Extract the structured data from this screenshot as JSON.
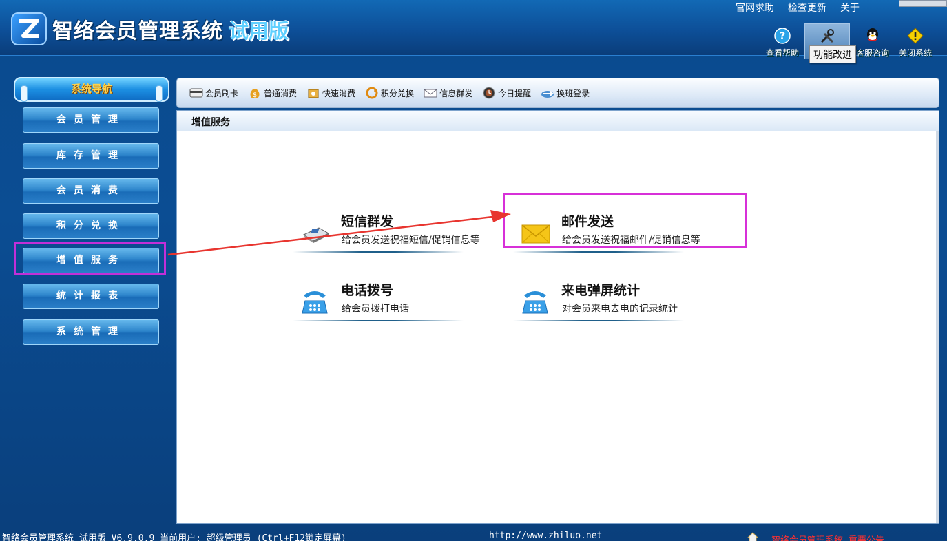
{
  "app": {
    "title": "智络会员管理系统",
    "edition": "试用版"
  },
  "top_links": [
    "官网求助",
    "检查更新",
    "关于"
  ],
  "tools": [
    {
      "label": "查看帮助",
      "icon": "help-icon"
    },
    {
      "label": "",
      "icon": "tools-icon"
    },
    {
      "label": "客服咨询",
      "icon": "qq-icon"
    },
    {
      "label": "关闭系统",
      "icon": "warning-icon"
    }
  ],
  "tooltip": "功能改进",
  "sidebar": {
    "title": "系统导航",
    "items": [
      {
        "label": "会员管理"
      },
      {
        "label": "库存管理"
      },
      {
        "label": "会员消费"
      },
      {
        "label": "积分兑换"
      },
      {
        "label": "增值服务"
      },
      {
        "label": "统计报表"
      },
      {
        "label": "系统管理"
      }
    ],
    "active_index": 4
  },
  "toolbar": {
    "items": [
      {
        "label": "会员刷卡",
        "icon": "card-icon"
      },
      {
        "label": "普通消费",
        "icon": "money-bag-icon"
      },
      {
        "label": "快速消费",
        "icon": "fast-consume-icon"
      },
      {
        "label": "积分兑换",
        "icon": "exchange-icon"
      },
      {
        "label": "信息群发",
        "icon": "message-icon"
      },
      {
        "label": "今日提醒",
        "icon": "clock-icon"
      },
      {
        "label": "换班登录",
        "icon": "shift-login-icon"
      }
    ]
  },
  "panel": {
    "title": "增值服务",
    "services": [
      {
        "title": "短信群发",
        "desc": "给会员发送祝福短信/促销信息等",
        "icon": "sms-device-icon"
      },
      {
        "title": "邮件发送",
        "desc": "给会员发送祝福邮件/促销信息等",
        "icon": "envelope-icon"
      },
      {
        "title": "电话拨号",
        "desc": "给会员拨打电话",
        "icon": "phone-icon"
      },
      {
        "title": "来电弹屏统计",
        "desc": "对会员来电去电的记录统计",
        "icon": "phone-icon"
      }
    ]
  },
  "status": {
    "text": "智络会员管理系统 试用版 V6.9.0.9 当前用户: 超级管理员 (Ctrl+F12锁定屏幕)",
    "url": "http://www.zhiluo.net",
    "notice": "智络会员管理系统 重要公告"
  },
  "colors": {
    "annotation": "#d730d8",
    "arrow": "#e8352f",
    "nav_title_text": "#ffd24a"
  }
}
